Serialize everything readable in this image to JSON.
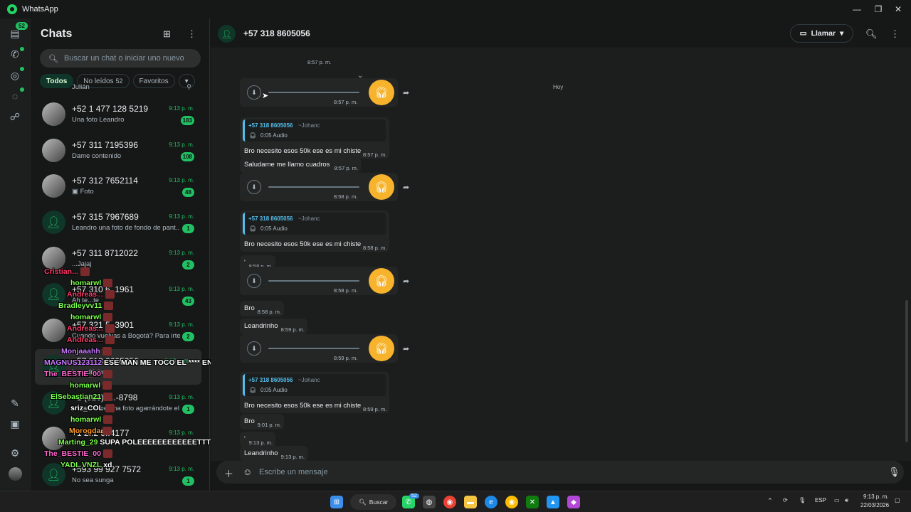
{
  "window": {
    "app_title": "WhatsApp",
    "controls": [
      "—",
      "❐",
      "✕"
    ]
  },
  "rail": {
    "chats_badge": "52"
  },
  "list": {
    "title": "Chats",
    "search_placeholder": "Buscar un chat o iniciar uno nuevo",
    "filters": {
      "all": "Todos",
      "unread": "No leídos",
      "unread_count": "52",
      "fav": "Favoritos"
    },
    "partial_top": "Julián",
    "chats": [
      {
        "name": "+52 1 477 128 5219",
        "time": "9:13 p. m.",
        "msg": "Una foto Leandro",
        "badge": "183"
      },
      {
        "name": "+57 311 7195396",
        "time": "9:13 p. m.",
        "msg": "Dame contenido",
        "badge": "108"
      },
      {
        "name": "+57 312 7652114",
        "time": "9:13 p. m.",
        "msg": "▣ Foto",
        "badge": "48"
      },
      {
        "name": "+57 315 7967689",
        "time": "9:13 p. m.",
        "msg": "Leandro una foto de fondo de pant...",
        "badge": "1"
      },
      {
        "name": "+57 311 8712022",
        "time": "9:13 p. m.",
        "msg": "...Jajaj",
        "badge": "2"
      },
      {
        "name": "+57 310 6..1961",
        "time": "9:13 p. m.",
        "msg": "Ah te...te",
        "badge": "43"
      },
      {
        "name": "+57 321 5..3901",
        "time": "9:13 p. m.",
        "msg": "Cuando vuelvas a Bogotá? Para irte...",
        "badge": "2"
      },
      {
        "name": "+57 318 8605056",
        "time": "9:13 p. m.",
        "msg": "Leandrinho",
        "badge": ""
      },
      {
        "name": "+1 (920) 4..-8798",
        "time": "9:13 p. m.",
        "msg": "...mandame una foto agarrándote el ...",
        "badge": "1"
      },
      {
        "name": "+1 2..2 5..4177",
        "time": "9:13 p. m.",
        "msg": "",
        "badge": ""
      },
      {
        "name": "+593 99 927 7572",
        "time": "9:13 p. m.",
        "msg": "No sea sunga",
        "badge": "1"
      }
    ]
  },
  "overlay": [
    {
      "user": "Cristian...",
      "color": "#ff3b6b",
      "text": ""
    },
    {
      "user": "homarwl",
      "color": "#7cff4f",
      "text": ""
    },
    {
      "user": "Andreas...",
      "color": "#ff3b6b",
      "text": ""
    },
    {
      "user": "Bradleyvv11",
      "color": "#7cff4f",
      "text": ""
    },
    {
      "user": "homarwl",
      "color": "#7cff4f",
      "text": ""
    },
    {
      "user": "Andreas...",
      "color": "#ff3b6b",
      "text": ""
    },
    {
      "user": "Andreas...",
      "color": "#ff3b6b",
      "text": ""
    },
    {
      "user": "Monjaaahh",
      "color": "#c87bff",
      "text": ""
    },
    {
      "user": "MAGNUS123112",
      "color": "#c87bff",
      "text": "ESE MAN ME TOCO EL **** EN BACHILLERATO"
    },
    {
      "user": "The_BESTIE_00",
      "color": "#ff66cc",
      "text": ""
    },
    {
      "user": "homarwl",
      "color": "#7cff4f",
      "text": ""
    },
    {
      "user": "ElSebastian21",
      "color": "#7cff4f",
      "text": ""
    },
    {
      "user": "sriz_COL",
      "color": "#ffffff",
      "text": ""
    },
    {
      "user": "homarwl",
      "color": "#7cff4f",
      "text": ""
    },
    {
      "user": "Morogda",
      "color": "#ff9a2a",
      "text": ""
    },
    {
      "user": "Marting_29",
      "color": "#7cff4f",
      "text": "SUPA POLEEEEEEEEEEEETTTTT"
    },
    {
      "user": "The_BESTIE_00",
      "color": "#ff66cc",
      "text": ""
    },
    {
      "user": "YADI_VNZL",
      "color": "#7cff4f",
      "text": "xd"
    }
  ],
  "conv": {
    "contact": "+57 318 8605056",
    "call_label": "Llamar",
    "day": "Hoy",
    "composer_placeholder": "Escribe un mensaje",
    "quote_name": "+57 318 8605056",
    "quote_alias": "~Johanc",
    "quote_duration": "0:05 Audio",
    "messages": [
      {
        "kind": "time",
        "time": "8:57 p. m."
      },
      {
        "kind": "audio",
        "time": "8:57 p. m."
      },
      {
        "kind": "reply",
        "text": "Bro necesito esos 50k ese es mi chiste",
        "time": "8:57 p. m."
      },
      {
        "kind": "text",
        "text": "Saludame me llamo cuadros",
        "time": "8:57 p. m."
      },
      {
        "kind": "audio",
        "time": "8:58 p. m."
      },
      {
        "kind": "reply",
        "text": "Bro necesito esos 50k ese es mi chiste",
        "time": "8:58 p. m."
      },
      {
        "kind": "text",
        "text": "'",
        "time": "8:58 p. m."
      },
      {
        "kind": "audio",
        "time": "8:58 p. m."
      },
      {
        "kind": "text",
        "text": "Bro",
        "time": "8:58 p. m."
      },
      {
        "kind": "text",
        "text": "Leandrinho",
        "time": "8:59 p. m."
      },
      {
        "kind": "audio",
        "time": "8:59 p. m."
      },
      {
        "kind": "reply",
        "text": "Bro necesito esos 50k ese es mi chiste",
        "time": "8:59 p. m."
      },
      {
        "kind": "text",
        "text": "Bro",
        "time": "9:01 p. m."
      },
      {
        "kind": "text",
        "text": "'",
        "time": "9:13 p. m."
      },
      {
        "kind": "text",
        "text": "Leandrinho",
        "time": "9:13 p. m."
      }
    ]
  },
  "taskbar": {
    "search_label": "Buscar",
    "lang": "ESP",
    "clock_time": "9:13 p. m.",
    "clock_date": "22/03/2026",
    "wa_badge": "52"
  },
  "colors": {
    "accent": "#21c063",
    "audio_icon": "#f7b32b",
    "quote_bar": "#53bdeb",
    "bubble": "#242626"
  }
}
